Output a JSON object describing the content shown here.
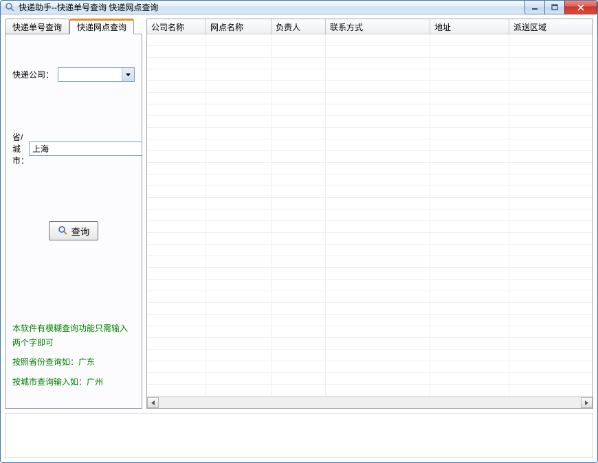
{
  "window": {
    "title": "快递助手--快递单号查询 快递网点查询"
  },
  "tabs": {
    "tracking": "快递单号查询",
    "branch": "快递网点查询"
  },
  "form": {
    "company_label": "快递公司：",
    "company_value": "",
    "city_label": "省/城市：",
    "city_value": "上海",
    "query_label": "查询"
  },
  "help": {
    "line1": "本软件有模糊查询功能只需输入两个字即可",
    "line2": "按照省份查询如：广东",
    "line3": "按城市查询输入如：广州"
  },
  "table": {
    "columns": [
      "公司名称",
      "网点名称",
      "负责人",
      "联系方式",
      "地址",
      "派送区域"
    ],
    "rows": []
  }
}
